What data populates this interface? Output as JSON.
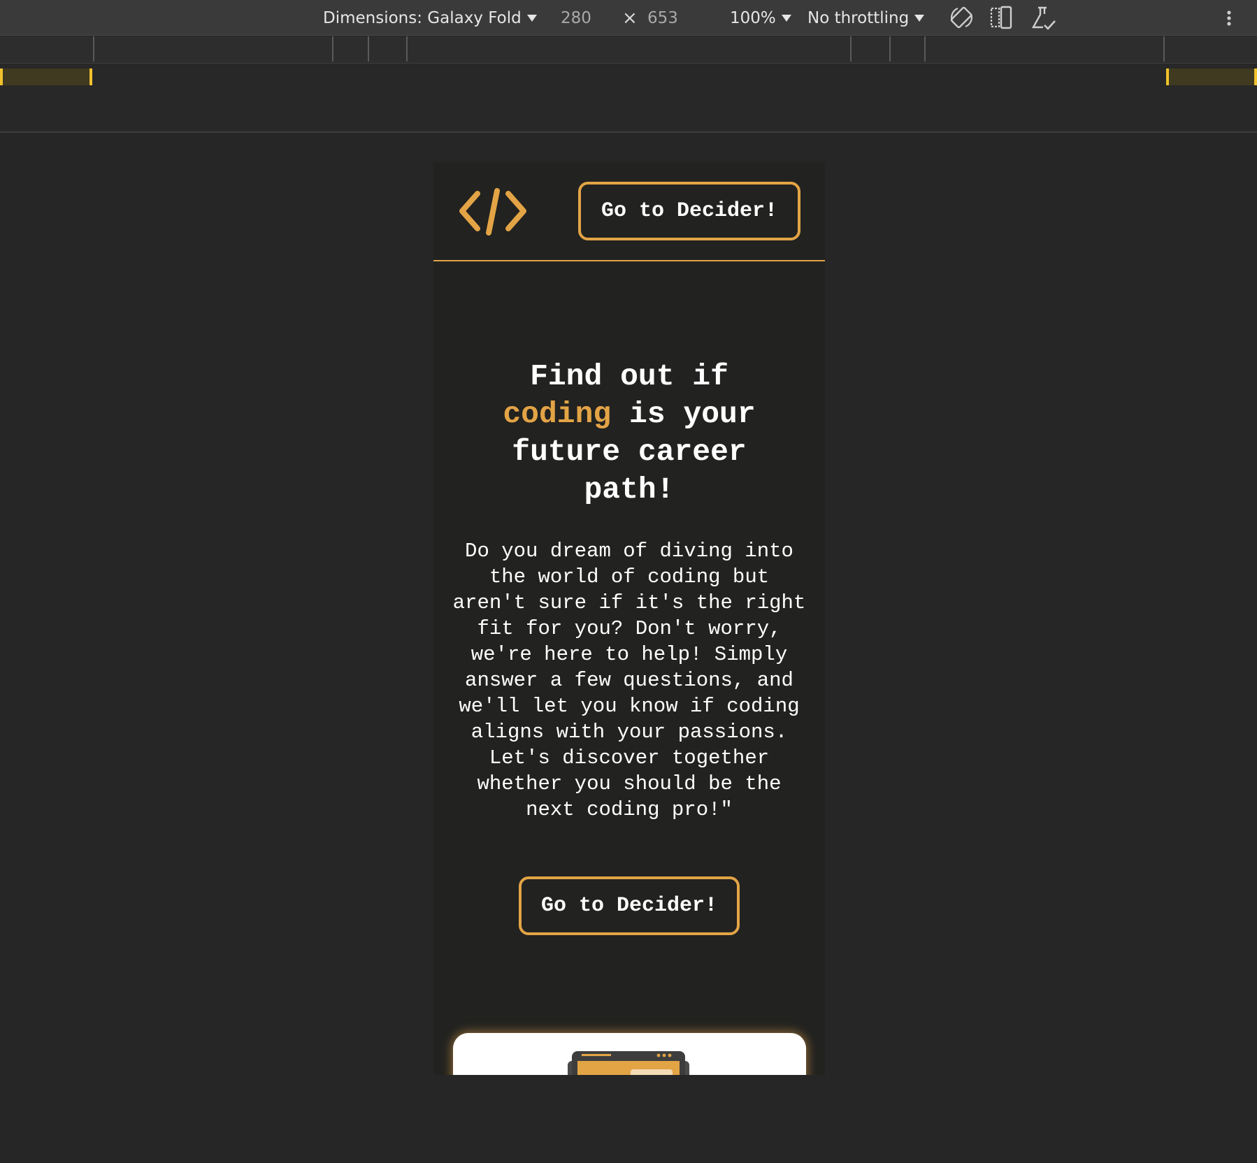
{
  "devtools": {
    "device_label": "Dimensions: Galaxy Fold",
    "width_value": "280",
    "times_symbol": "×",
    "height_value": "653",
    "zoom_label": "100%",
    "throttling_label": "No throttling",
    "icons": [
      "rotate-icon",
      "dual-screen-icon",
      "sensors-flask-icon",
      "more-options-icon"
    ]
  },
  "site": {
    "header_button_label": "Go to Decider!",
    "hero_title_line1": "Find out if",
    "hero_title_accent": "coding",
    "hero_title_rest": " is your future career path!",
    "hero_text": "Do you dream of diving into the world of coding but aren't sure if it's the right fit for you? Don't worry, we're here to help! Simply answer a few questions, and we'll let you know if coding aligns with your passions. Let's discover together whether you should be the next coding pro!\"",
    "hero_button_label": "Go to Decider!",
    "colors": {
      "accent": "#e3a446",
      "background": "#222220",
      "text": "#ffffff"
    }
  }
}
